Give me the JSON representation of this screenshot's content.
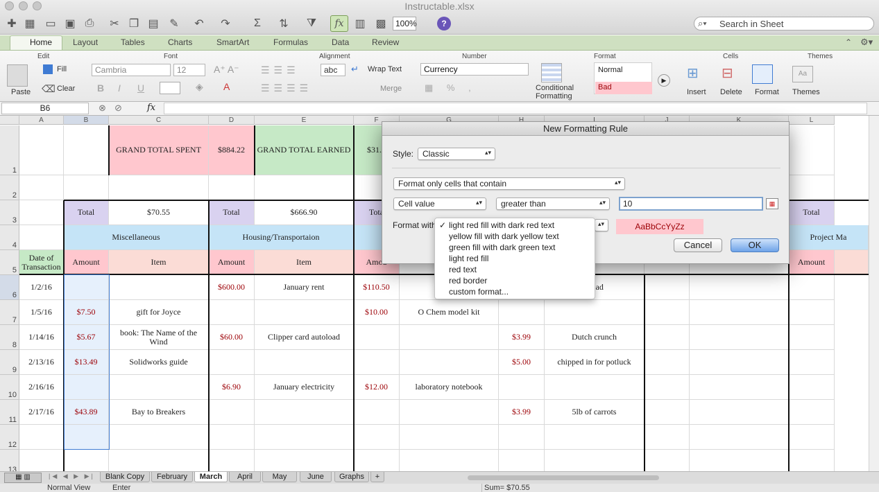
{
  "window": {
    "title": "Instructable.xlsx",
    "zoom": "100%",
    "search_placeholder": "Search in Sheet"
  },
  "ribbon_tabs": [
    "Home",
    "Layout",
    "Tables",
    "Charts",
    "SmartArt",
    "Formulas",
    "Data",
    "Review"
  ],
  "ribbon": {
    "groups": {
      "edit": "Edit",
      "font": "Font",
      "alignment": "Alignment",
      "number": "Number",
      "format": "Format",
      "cells": "Cells",
      "themes": "Themes"
    },
    "paste": "Paste",
    "fill": "Fill",
    "clear": "Clear",
    "font_name": "Cambria",
    "font_size": "12",
    "wrap_text": "Wrap Text",
    "merge": "Merge",
    "abc": "abc",
    "number_format": "Currency",
    "conditional_formatting_1": "Conditional",
    "conditional_formatting_2": "Formatting",
    "style_normal": "Normal",
    "style_bad": "Bad",
    "insert": "Insert",
    "delete": "Delete",
    "format_btn": "Format",
    "themes_btn": "Themes"
  },
  "formula_bar": {
    "name_box": "B6",
    "fx": "fx"
  },
  "columns": [
    "A",
    "B",
    "C",
    "D",
    "E",
    "F",
    "G",
    "H",
    "I",
    "J",
    "K",
    "L"
  ],
  "rows": [
    "1",
    "2",
    "3",
    "4",
    "5",
    "6",
    "7",
    "8",
    "9",
    "10",
    "11",
    "12",
    "13"
  ],
  "sheet": {
    "grand_total_spent_label": "GRAND TOTAL SPENT",
    "grand_total_spent": "$884.22",
    "grand_total_earned_label": "GRAND TOTAL EARNED",
    "grand_total_earned_partial": "$31.4",
    "total_label": "Total",
    "total_misc": "$70.55",
    "total_housing": "$666.90",
    "total_partial": "Tota",
    "cat_misc": "Miscellaneous",
    "cat_housing": "Housing/Transportaion",
    "cat_project": "Project Ma",
    "date_header": "Date of Transaction",
    "amount_header": "Amount",
    "amount_partial": "Amou",
    "item_header": "Item",
    "dates": [
      "1/2/16",
      "1/5/16",
      "1/14/16",
      "2/13/16",
      "2/16/16",
      "2/17/16"
    ],
    "misc_amounts": [
      "",
      "$7.50",
      "$5.67",
      "$13.49",
      "",
      "$43.89"
    ],
    "misc_items": [
      "",
      "gift for Joyce",
      "book: The Name of the Wind",
      "Solidworks guide",
      "",
      "Bay to Breakers"
    ],
    "housing_amounts": [
      "$600.00",
      "",
      "$60.00",
      "",
      "$6.90",
      ""
    ],
    "housing_items": [
      "January rent",
      "",
      "Clipper card autoload",
      "",
      "January electricity",
      ""
    ],
    "f_amounts": [
      "$110.50",
      "$10.00",
      "",
      "",
      "$12.00",
      ""
    ],
    "g_items": [
      "Me",
      "O Chem model kit",
      "",
      "",
      "laboratory notebook",
      ""
    ],
    "h_amounts": [
      "",
      "",
      "$3.99",
      "$5.00",
      "",
      "$3.99"
    ],
    "i_items": [
      "bread",
      "",
      "Dutch crunch",
      "chipped in for potluck",
      "",
      "5lb of carrots"
    ]
  },
  "dialog": {
    "title": "New Formatting Rule",
    "style_label": "Style:",
    "style_value": "Classic",
    "rule_type": "Format only cells that contain",
    "condition_field": "Cell value",
    "operator": "greater than",
    "value": "10",
    "format_with_label": "Format with",
    "preview": "AaBbCcYyZz",
    "cancel": "Cancel",
    "ok": "OK"
  },
  "format_menu": {
    "items": [
      "light red fill with dark red text",
      "yellow fill with dark yellow text",
      "green fill with dark green text",
      "light red fill",
      "red text",
      "red border",
      "custom format..."
    ],
    "checked": "✓"
  },
  "sheet_tabs": [
    "Blank Copy",
    "February",
    "March",
    "April",
    "May",
    "June",
    "Graphs"
  ],
  "active_tab": "March",
  "add_tab": "+",
  "status": {
    "view": "Normal View",
    "mode": "Enter",
    "sum": "Sum= $70.55"
  },
  "colors": {
    "pink": "#ffc7ce",
    "green": "#c6e9c6",
    "purple": "#d9d2f0",
    "blue": "#c5e4f7",
    "peach": "#fbdcd6",
    "selection": "#e6f0fc"
  }
}
